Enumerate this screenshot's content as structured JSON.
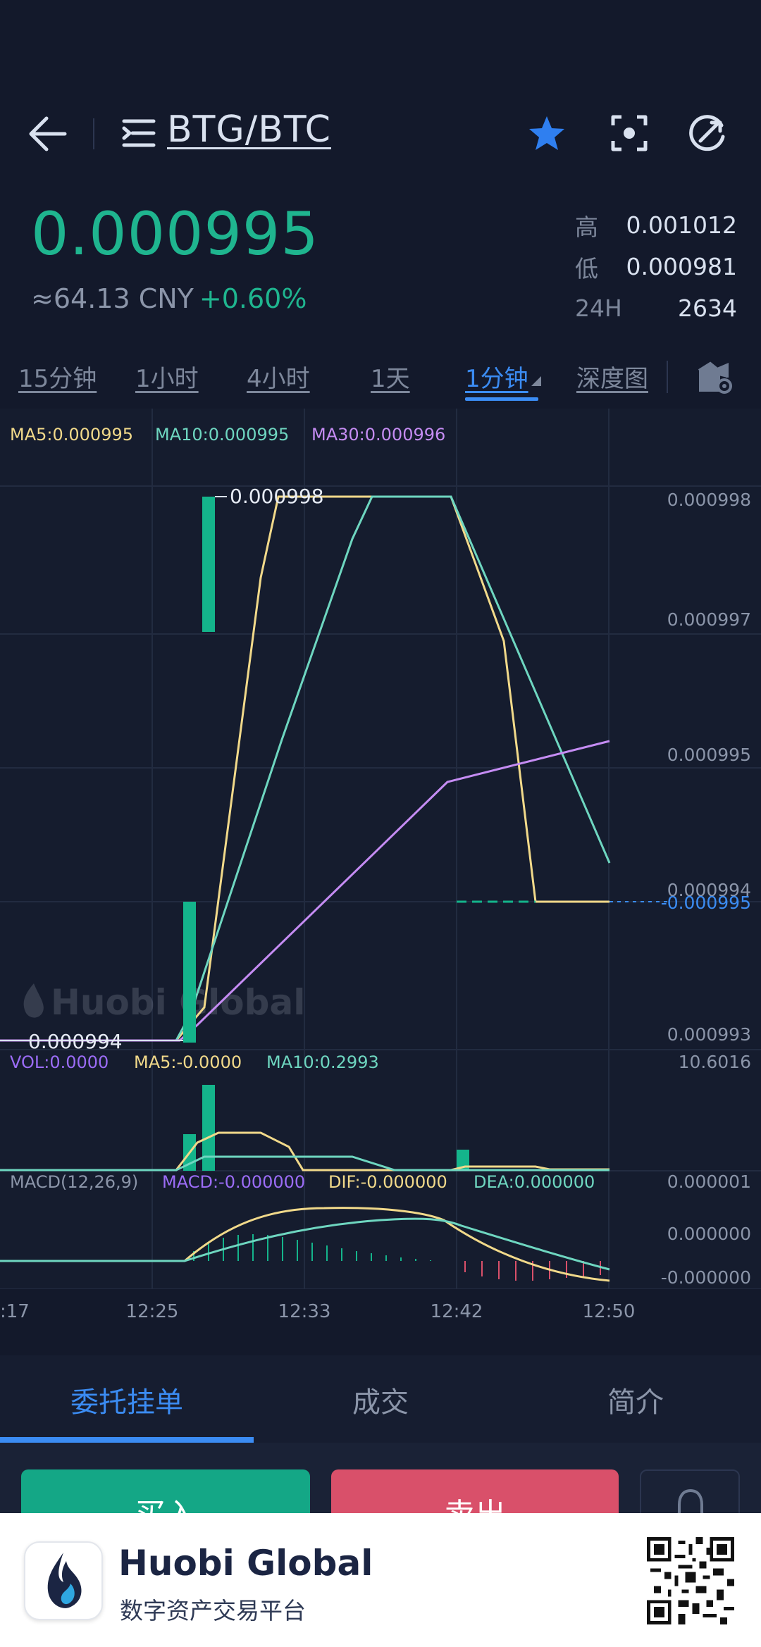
{
  "header": {
    "pair": "BTG/BTC",
    "icons": [
      "back-arrow-icon",
      "menu-icon",
      "star-icon",
      "scan-icon",
      "refresh-icon"
    ]
  },
  "price": {
    "last": "0.000995",
    "cny": "≈64.13 CNY",
    "change": "+0.60%"
  },
  "stats": [
    {
      "label": "高",
      "value": "0.001012"
    },
    {
      "label": "低",
      "value": "0.000981"
    },
    {
      "label": "24H",
      "value": "2634"
    }
  ],
  "periods": [
    {
      "label": "15分钟",
      "active": false
    },
    {
      "label": "1小时",
      "active": false
    },
    {
      "label": "4小时",
      "active": false
    },
    {
      "label": "1天",
      "active": false
    },
    {
      "label": "1分钟",
      "active": true
    },
    {
      "label": "深度图",
      "active": false
    }
  ],
  "chart": {
    "legend_main": {
      "ma5": "MA5:0.000995",
      "ma10": "MA10:0.000995",
      "ma30": "MA30:0.000996"
    },
    "price_ticks": [
      "0.000998",
      "0.000997",
      "0.000995",
      "0.000994",
      "0.000993"
    ],
    "current_price_label": "-0.000995",
    "max_label": "0.000998",
    "min_label": "0.000994",
    "watermark": "Huobi Global",
    "vol_legend": {
      "vol": "VOL:0.0000",
      "ma5": "MA5:-0.0000",
      "ma10": "MA10:0.2993"
    },
    "vol_max": "10.6016",
    "macd_legend": {
      "title": "MACD(12,26,9)",
      "macd": "MACD:-0.000000",
      "dif": "DIF:-0.000000",
      "dea": "DEA:0.000000"
    },
    "macd_ticks": [
      "0.000001",
      "0.000000",
      "-0.000000"
    ],
    "time_ticks": [
      ":17",
      "12:25",
      "12:33",
      "12:42",
      "12:50"
    ],
    "colors": {
      "ma5": "#f1d98a",
      "ma10": "#6ed6c0",
      "ma30": "#c58cf3",
      "up": "#14b48b",
      "down": "#d9506a",
      "accent": "#3b8cf3"
    }
  },
  "tabs": [
    {
      "label": "委托挂单",
      "active": true
    },
    {
      "label": "成交",
      "active": false
    },
    {
      "label": "简介",
      "active": false
    }
  ],
  "actions": {
    "buy": "买入",
    "sell": "卖出"
  },
  "footer": {
    "app_name": "Huobi Global",
    "tagline": "数字资产交易平台"
  }
}
